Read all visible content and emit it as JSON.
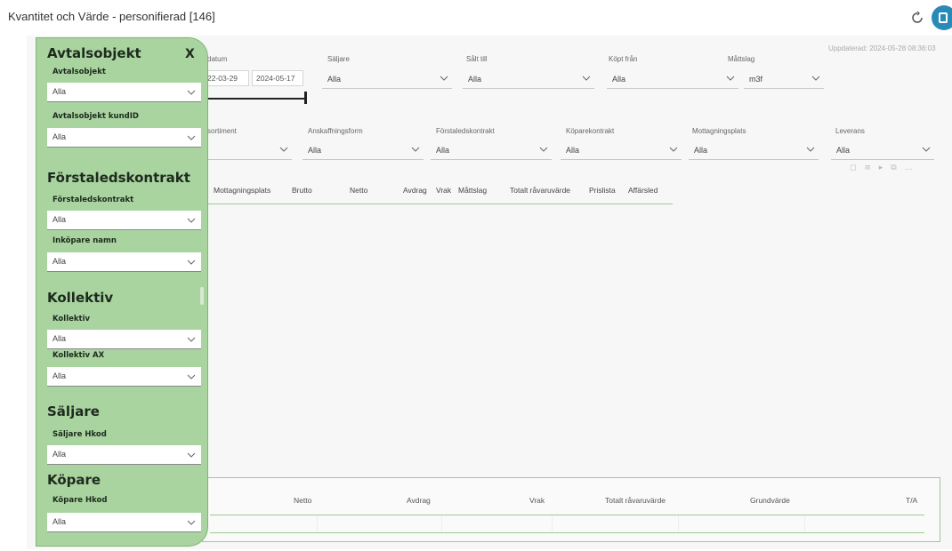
{
  "app": {
    "title": "Kvantitet och Värde - personifierad [146]",
    "updated": "Uppdaterad: 2024-05-28 08:36:03",
    "accent_color": "#2a8ab7",
    "panel_color": "#a9d4a0"
  },
  "filters_row1": {
    "datum_label": "datum",
    "date_from": "22-03-29",
    "date_to": "2024-05-17",
    "saljare_label": "Säljare",
    "saljare_value": "Alla",
    "salt_till_label": "Sålt till",
    "salt_till_value": "Alla",
    "kopt_fran_label": "Köpt från",
    "kopt_fran_value": "Alla",
    "mattslag_label": "Måttslag",
    "mattslag_value": "m3f"
  },
  "filters_row2": {
    "sortiment_label": "sortiment",
    "sortiment_value": "",
    "anskaffningsform_label": "Anskaffningsform",
    "anskaffningsform_value": "Alla",
    "forstaledskontrakt_label": "Förstaledskontrakt",
    "forstaledskontrakt_value": "Alla",
    "koparekontrakt_label": "Köparekontrakt",
    "koparekontrakt_value": "Alla",
    "mottagningsplats_label": "Mottagningsplats",
    "mottagningsplats_value": "Alla",
    "leverans_label": "Leverans",
    "leverans_value": "Alla"
  },
  "table": {
    "columns": [
      "Mottagningsplats",
      "Brutto",
      "Netto",
      "Avdrag",
      "Vrak",
      "Måttslag",
      "Totalt råvaruvärde",
      "Prislista",
      "Affärsled"
    ]
  },
  "summary": {
    "columns": [
      "Netto",
      "Avdrag",
      "Vrak",
      "Totalt råvaruvärde",
      "Grundvärde",
      "T/A"
    ]
  },
  "panel": {
    "close_label": "X",
    "sections": {
      "avtalsobjekt": "Avtalsobjekt",
      "forstaledskontrakt": "Förstaledskontrakt",
      "kollektiv": "Kollektiv",
      "saljare": "Säljare",
      "kopare": "Köpare"
    },
    "fields": [
      {
        "label": "Avtalsobjekt",
        "value": "Alla"
      },
      {
        "label": "Avtalsobjekt kundID",
        "value": "Alla"
      },
      {
        "label": "Förstaledskontrakt",
        "value": "Alla"
      },
      {
        "label": "Inköpare namn",
        "value": "Alla"
      },
      {
        "label": "Kollektiv",
        "value": "Alla"
      },
      {
        "label": "Kollektiv AX",
        "value": "Alla"
      },
      {
        "label": "Säljare Hkod",
        "value": "Alla"
      },
      {
        "label": "Köpare Hkod",
        "value": "Alla"
      }
    ]
  }
}
